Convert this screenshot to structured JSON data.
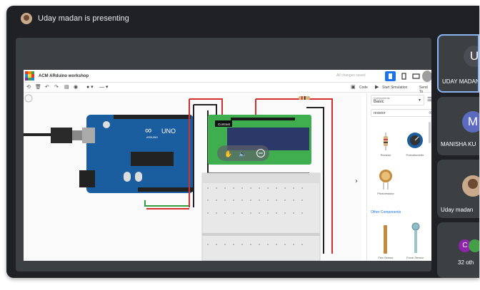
{
  "meet": {
    "presenter_banner": "Uday madan is presenting",
    "participants": [
      {
        "initial": "U",
        "name": "UDAY MADAN",
        "avatar_color": "#4a4d51",
        "active": true
      },
      {
        "initial": "M",
        "name": "MANISHA KU",
        "avatar_color": "#5c6bc0",
        "active": false
      },
      {
        "initial": "",
        "name": "Uday madan",
        "avatar_color": "#c9a98a",
        "active": false
      },
      {
        "initial": "C",
        "name": "32 oth",
        "avatar_color": "#8e24aa",
        "active": false
      }
    ],
    "colors": {
      "bg": "#202124",
      "tile": "#3c4043",
      "active_border": "#8ab4f8"
    }
  },
  "tinkercad": {
    "project_title": "ACM ARduino workshop",
    "save_status": "All changes saved",
    "toolbar": {
      "code_label": "Code",
      "start_sim_label": "Start Simulation",
      "send_to_label": "Send To"
    },
    "canvas": {
      "contrast_tooltip": "Contrast",
      "board_logo_text": "UNO",
      "board_brand": "ARDUINO",
      "overlay_icons": [
        "hand-icon",
        "volume-icon",
        "minus-circle-icon"
      ]
    },
    "components_panel": {
      "header_label": "Components",
      "category": "Basic",
      "search_value": "resistor",
      "items": [
        {
          "label": "Resistor",
          "icon": "resistor-icon"
        },
        {
          "label": "Potentiometer",
          "icon": "potentiometer-icon"
        },
        {
          "label": "Photoresistor",
          "icon": "photoresistor-icon"
        }
      ],
      "other_components_label": "Other Components",
      "other_items": [
        {
          "label": "Flex Sensor",
          "icon": "flex-sensor-icon"
        },
        {
          "label": "Force Sensor",
          "icon": "force-sensor-icon"
        }
      ]
    },
    "colors": {
      "accent": "#1a73e8",
      "arduino_blue": "#1b5ea0",
      "lcd_green": "#3fae4e",
      "lcd_screen": "#2c3968",
      "wire_red": "#d32f2f",
      "wire_green": "#2e9e3f"
    }
  }
}
